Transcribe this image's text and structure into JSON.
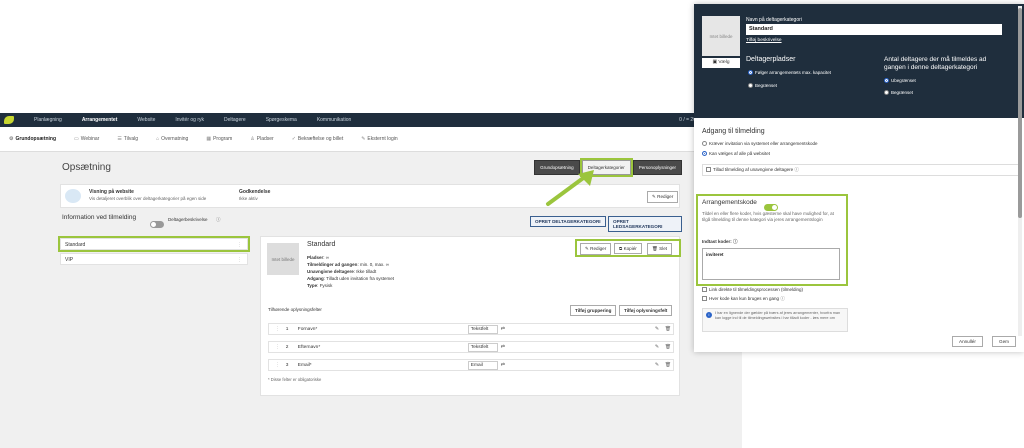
{
  "topnav": {
    "items": [
      "Planlægning",
      "Arrangementet",
      "Website",
      "Invitér og ryk",
      "Deltagere",
      "Spørgeskema",
      "Kommunikation"
    ],
    "active_index": 1,
    "count": "0 / = 20"
  },
  "subnav": {
    "items": [
      {
        "label": "Grundopsætning",
        "icon": "gear-icon",
        "glyph": "⚙"
      },
      {
        "label": "Webinar",
        "icon": "webinar-icon",
        "glyph": "▭"
      },
      {
        "label": "Tilvalg",
        "icon": "options-icon",
        "glyph": "☰"
      },
      {
        "label": "Overnatning",
        "icon": "bed-icon",
        "glyph": "⌂"
      },
      {
        "label": "Program",
        "icon": "calendar-icon",
        "glyph": "▦"
      },
      {
        "label": "Pladser",
        "icon": "seat-icon",
        "glyph": "♙"
      },
      {
        "label": "Bekræftelse og billet",
        "icon": "check-icon",
        "glyph": "✓"
      },
      {
        "label": "Eksternt login",
        "icon": "pencil-icon",
        "glyph": "✎"
      }
    ],
    "active_index": 0
  },
  "page": {
    "title": "Opsætning",
    "tabs": [
      "Grundopsætning",
      "Deltagerkategorier",
      "Personoplysninger"
    ],
    "selected_tab": 1
  },
  "info_card": {
    "heading": "Visning på website",
    "text": "Vis detaljeret overblik over deltagerkategorier på egen side",
    "approval_label": "Godkendelse",
    "approval_value": "Ikke aktiv",
    "edit_label": "Rediger"
  },
  "info_section": {
    "heading": "Information ved tilmelding",
    "toggle_label": "Deltagerbeskrivelse",
    "btn_create_category": "OPRET DELTAGERKATEGORI",
    "btn_create_companion": "OPRET LEDSAGERKATEGORI"
  },
  "categories": [
    "Standard",
    "VIP"
  ],
  "detail": {
    "image_label": "Intet billede",
    "name": "Standard",
    "rows": [
      {
        "label": "Pladser",
        "value": "∞"
      },
      {
        "label": "Tilmeldinger ad gangen",
        "value": "min. 0, max. ∞"
      },
      {
        "label": "Unavngivne deltagere",
        "value": "Ikke tilladt"
      },
      {
        "label": "Adgang",
        "value": "Tilladt uden invitation fra systemet"
      },
      {
        "label": "Type",
        "value": "Fysisk"
      }
    ],
    "actions": [
      "Rediger",
      "Kopiér",
      "Slet"
    ],
    "fields_title": "Tilhørende oplysningsfelter",
    "btn_add_group": "Tilføj gruppering",
    "btn_add_field": "Tilføj oplysningsfelt",
    "fields": [
      {
        "num": "1",
        "name": "Fornavn*",
        "type": "Tekstfelt"
      },
      {
        "num": "2",
        "name": "Efternavn*",
        "type": "Tekstfelt"
      },
      {
        "num": "3",
        "name": "Email*",
        "type": "Email"
      }
    ],
    "footnote": "* Disse felter er obligatoriske"
  },
  "modal": {
    "image_label": "Intet billede",
    "choose_label": "Vælg",
    "name_label": "Navn på deltagerkategori",
    "name_value": "Standard",
    "add_description": "Tilføj beskrivelse",
    "places_heading": "Deltagerpladser",
    "places_options": [
      "Følger arrangementets max. kapacitet",
      "Begrænset"
    ],
    "places_selected": 0,
    "count_heading": "Antal deltagere der må tilmeldes ad gangen i denne deltagerkategori",
    "count_options": [
      "Ubegrænset",
      "Begrænset"
    ],
    "count_selected": 0,
    "access_heading": "Adgang til tilmelding",
    "access_options": [
      "Kræver invitation via systemet eller arrangementskode",
      "Kan vælges af alle på websitet"
    ],
    "access_selected": 1,
    "allow_unnamed": "Tillad tilmelding af unavngivne deltagere",
    "code_heading": "Arrangementskode",
    "code_desc": "Tildel en eller flere koder, hvis gæsterne skal have mulighed for, at tilgå tilmelding til denne kategori via jeres arrangementslogin",
    "code_input_label": "Indtast koder:",
    "code_value": "inviteret",
    "link_direct": "Link direkte til tilmeldingsprocessen (tilmelding)",
    "once_only": "Hver kode kan kun bruges en gang",
    "note": "I har en lignende der gælder på tværs af jeres arrangementer, hvorfra man kan logge ind til de tilmeldingswebsites i har tilladt koder - læs mere om",
    "cancel": "Annullér",
    "save": "Gem"
  },
  "colors": {
    "nav_dark": "#1f2e3d",
    "highlight": "#9bc53d",
    "radio": "#2a63c8"
  }
}
